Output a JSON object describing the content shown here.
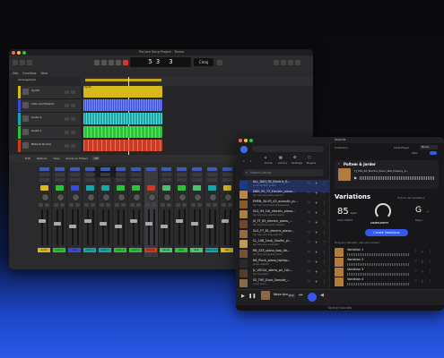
{
  "daw": {
    "window_title": "Pro Jam Song Project - Tracks",
    "lcd": {
      "bars": "5",
      "beats": "3",
      "tempo": "3",
      "key": "Cmaj"
    },
    "menu": [
      "Edit",
      "Functions",
      "View"
    ],
    "arrangement_label": "Arrangement",
    "tracks": [
      {
        "name": "Synth",
        "color": "#d6b91b"
      },
      {
        "name": "Intro and Extend",
        "color": "#3a4ad8"
      },
      {
        "name": "Audio 4",
        "color": "#18a7a7"
      },
      {
        "name": "Audio 1",
        "color": "#2ec13a"
      },
      {
        "name": "Natural Drums",
        "color": "#cc3a22"
      },
      {
        "name": "Factory Verb",
        "color": "#3a4ad8"
      }
    ],
    "mixer_tabs": [
      "Edit",
      "Options",
      "View",
      "Sends on Faders",
      "Off"
    ],
    "mixer_right_tabs": [
      "Single",
      "Tracks",
      "All"
    ],
    "channel_names": [
      "Synth",
      "Audio 1",
      "Intro",
      "Audio 4",
      "Audio 3",
      "Audio 6",
      "Audio 5",
      "Drums",
      "Sends",
      "Verb",
      "Rvb",
      "Stereo Out",
      "Out",
      "Master",
      "Bnce"
    ],
    "channel_colors": [
      "#d6b91b",
      "#2ec13a",
      "#3a4ad8",
      "#18a7a7",
      "#18a7a7",
      "#2ec13a",
      "#2ec13a",
      "#cc3a22",
      "#4ac46a",
      "#2ec13a",
      "#4ac46a",
      "#18a7a7",
      "#d6b91b",
      "#cc3a99",
      "#aaa"
    ]
  },
  "splice": {
    "window_title": "Sounds",
    "nav": [
      {
        "icon": "⌂",
        "label": "Home"
      },
      {
        "icon": "▦",
        "label": "Library"
      },
      {
        "icon": "⚙",
        "label": "Settings"
      },
      {
        "icon": "⬡",
        "label": "Plugins"
      }
    ],
    "filters": [
      "Samples",
      "Presets",
      "Packs",
      "Instr",
      "Kits",
      "Pack"
    ],
    "search_placeholder": "Search Library",
    "results": [
      {
        "name": "ALL_DAH_92_Electric_K...",
        "tags": "vocal  electric  guitar",
        "thumb": "#1b3a8a"
      },
      {
        "name": "DMS_95_73_Electric_piano...",
        "tags": "hip hop  soul  piano  electric",
        "thumb": "#c2843a"
      },
      {
        "name": "EHRN_30-95_A3_acoustic_pi...",
        "tags": "hip hop  vocal  keys  progressive",
        "thumb": "#8a5a2a"
      },
      {
        "name": "SLG_99_G#_electric_piano...",
        "tags": "hip hop  keys  electric piano",
        "thumb": "#b47c3a"
      },
      {
        "name": "JS_FT_83_electric_piano_...",
        "tags": "hip hop  funk  piano  melodic",
        "thumb": "#6a4a2a"
      },
      {
        "name": "SLG_FT_81_electric_piano...",
        "tags": "hip hop  soul  keys  electric",
        "thumb": "#9a6a3a"
      },
      {
        "name": "CL_108_Cmaj_Soulful_pi...",
        "tags": "hip hop  soul  cinematic",
        "thumb": "#c09a5a"
      },
      {
        "name": "RB_ZZS_piano_loop_Ab...",
        "tags": "hip hop  soul  guitar  piano",
        "thumb": "#7a5030"
      },
      {
        "name": "NS_Pluck_piano_hiphop...",
        "tags": "guitar  electric",
        "thumb": "#2a2a2a"
      },
      {
        "name": "JL_VOCAL_stems_pn_101...",
        "tags": "hip hop  piano",
        "thumb": "#5a3a2a"
      },
      {
        "name": "SS_THE_Duck_Sample_...",
        "tags": "vocal  piano",
        "thumb": "#8a6a4a"
      }
    ],
    "right": {
      "collection_label": "Collection",
      "pack_name": "Poltem & Jorder",
      "sample_name": "TJ_S59_B3_Electric_Piano_Wet_Dreamy_K...",
      "variations_title": "Variations",
      "how_link": "How to use Variations",
      "tempo_value": "85",
      "tempo_unit": "bpm",
      "tempo_label": "HOST TEMPO",
      "complexity_label": "COMPLEXITY",
      "key_value": "G",
      "key_scale": "Major",
      "create_button": "Create Variations",
      "drag_hint": "Drag any Variation into your project",
      "variations": [
        "Variation 1",
        "Variation 2",
        "Variation 3",
        "Variation 4",
        "Variation 5"
      ]
    },
    "player": {
      "track": "Neon Acres",
      "meta": "Main"
    },
    "footer": "Splice Sounds",
    "top_right": {
      "slide_label": "Slide Player",
      "slide_value": "None",
      "wav_label": "Wav"
    }
  }
}
